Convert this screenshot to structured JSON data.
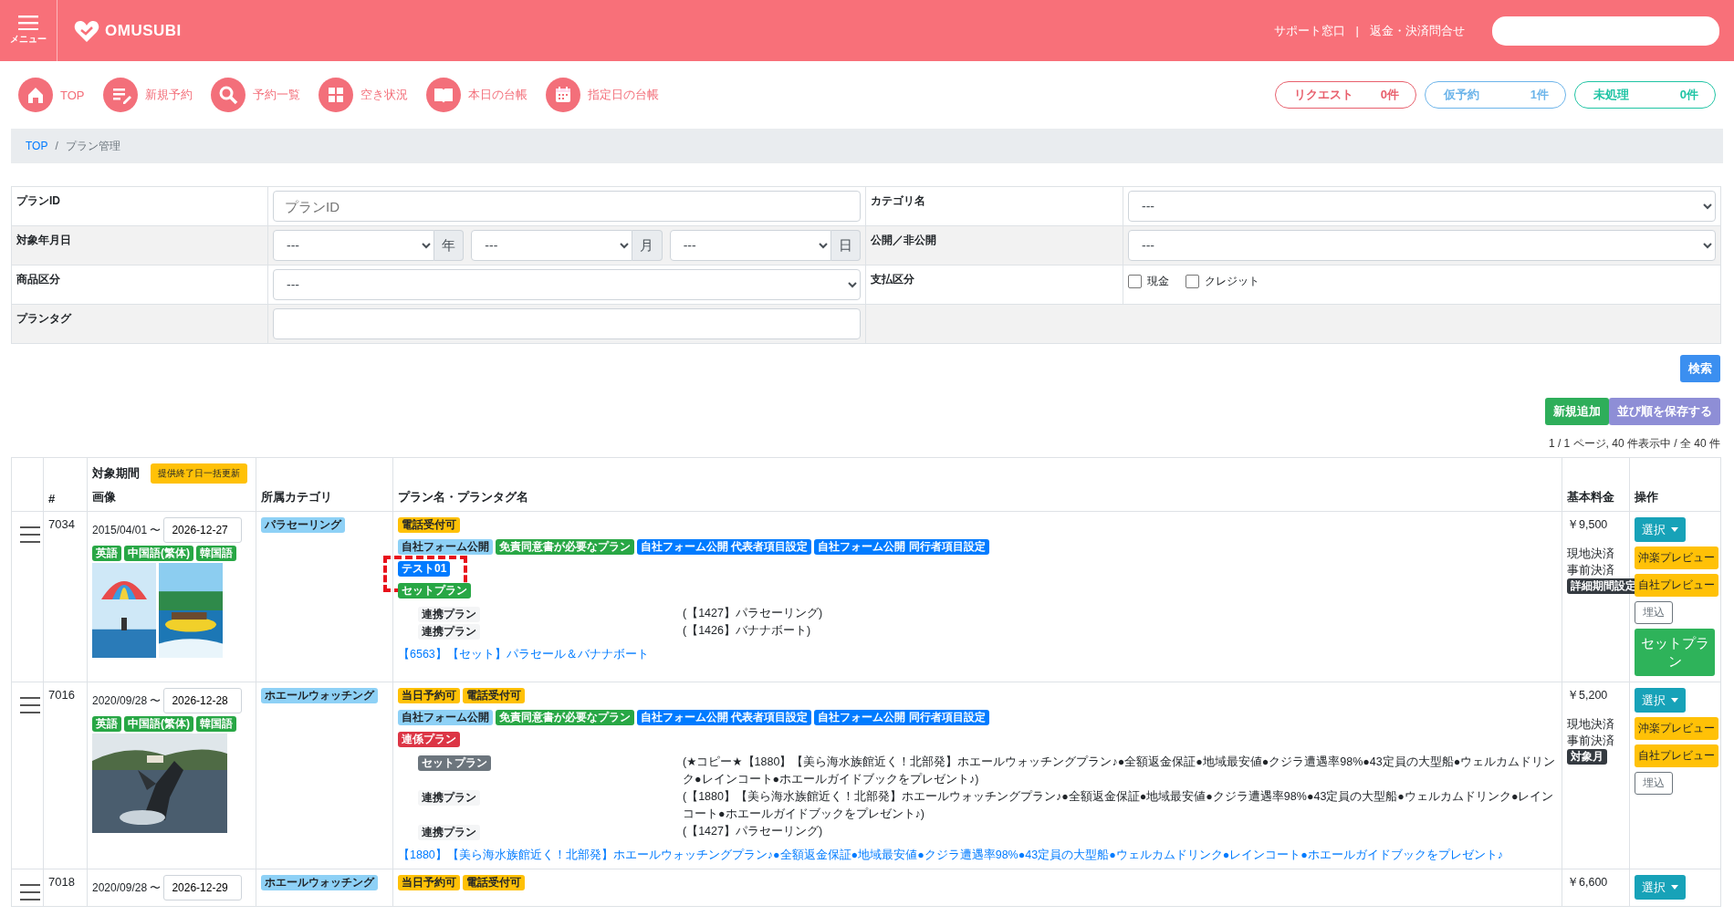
{
  "header": {
    "menu_label": "メニュー",
    "logo": "OMUSUBI",
    "links": [
      "サポート窓口",
      "返金・決済問合せ"
    ],
    "separator": "|"
  },
  "toolbar": [
    {
      "label": "TOP"
    },
    {
      "label": "新規予約"
    },
    {
      "label": "予約一覧"
    },
    {
      "label": "空き状況"
    },
    {
      "label": "本日の台帳"
    },
    {
      "label": "指定日の台帳"
    }
  ],
  "counters": [
    {
      "label": "リクエスト",
      "count": "0件",
      "color": "#e8606d"
    },
    {
      "label": "仮予約",
      "count": "1件",
      "color": "#6cb4ea"
    },
    {
      "label": "未処理",
      "count": "0件",
      "color": "#1fc4a4"
    }
  ],
  "breadcrumb": [
    {
      "label": "TOP",
      "link": true
    },
    {
      "label": "プラン管理",
      "link": false
    }
  ],
  "breadcrumb_separator": "/",
  "filters": [
    {
      "label": "プランID",
      "kind": "text",
      "placeholder": "プランID"
    },
    {
      "label": "カテゴリ名",
      "kind": "select",
      "value": "---"
    },
    {
      "label": "対象年月日",
      "kind": "date",
      "parts": [
        {
          "value": "---",
          "unit": "年"
        },
        {
          "value": "---",
          "unit": "月"
        },
        {
          "value": "---",
          "unit": "日"
        }
      ]
    },
    {
      "label": "公開／非公開",
      "kind": "select",
      "value": "---"
    },
    {
      "label": "商品区分",
      "kind": "select",
      "value": "---"
    },
    {
      "label": "支払区分",
      "kind": "checks",
      "options": [
        {
          "label": "現金",
          "checked": false
        },
        {
          "label": "クレジット",
          "checked": false
        }
      ]
    },
    {
      "label": "プランタグ",
      "kind": "text"
    }
  ],
  "search_button": "検索",
  "add_button": "新規追加",
  "save_order_button": "並び順を保存する",
  "pagination": "1 / 1 ページ, 40 件表示中 / 全 40 件",
  "table": {
    "columns": {
      "number": "#",
      "period": "対象期間",
      "bulk_update_button": "提供終了日一括更新",
      "image": "画像",
      "category": "所属カテゴリ",
      "plan": "プラン名・プランタグ名",
      "price": "基本料金",
      "actions": "操作"
    },
    "rows": [
      {
        "id": "7034",
        "start": "2015/04/01 〜",
        "end": "2026-12-27",
        "languages": [
          "英語",
          "中国語(繁体)",
          "韓国語"
        ],
        "images": [
          {
            "kind": "picture"
          },
          {
            "kind": "picture"
          }
        ],
        "category": "パラセーリング",
        "tag_rows": [
          [
            {
              "text": "電話受付可",
              "kind": "warning",
              "highlighted": false
            }
          ],
          [
            {
              "text": "自社フォーム公開",
              "kind": "info",
              "highlighted": false
            },
            {
              "text": "免責同意書が必要なプラン",
              "kind": "success",
              "highlighted": false
            },
            {
              "text": "自社フォーム公開 代表者項目設定",
              "kind": "primary",
              "highlighted": false
            },
            {
              "text": "自社フォーム公開 同行者項目設定",
              "kind": "primary",
              "highlighted": false
            }
          ],
          [
            {
              "text": "テスト01",
              "kind": "primary",
              "highlighted": true
            }
          ],
          [
            {
              "text": "セットプラン",
              "kind": "success",
              "highlighted": false
            }
          ]
        ],
        "linked_plans": [
          {
            "label": "連携プラン",
            "kind": "light",
            "text": "(【1427】パラセーリング)"
          },
          {
            "label": "連携プラン",
            "kind": "light",
            "text": "(【1426】バナナボート)"
          }
        ],
        "plan_link": "【6563】【セット】パラセール＆バナナボート",
        "price": "￥9,500",
        "payments": [
          "現地決済",
          "事前決済"
        ],
        "period_badge": "詳細期間設定",
        "actions": [
          {
            "label": "選択",
            "kind": "dropdown"
          },
          {
            "label": "沖楽プレビュー",
            "kind": "warning"
          },
          {
            "label": "自社プレビュー",
            "kind": "warning"
          },
          {
            "label": "埋込",
            "kind": "outline"
          },
          {
            "label": "セットプラン",
            "kind": "success"
          }
        ]
      },
      {
        "id": "7016",
        "start": "2020/09/28 〜",
        "end": "2026-12-28",
        "languages": [
          "英語",
          "中国語(繁体)",
          "韓国語"
        ],
        "images": [
          {
            "kind": "picture"
          }
        ],
        "category": "ホエールウォッチング",
        "tag_rows": [
          [
            {
              "text": "当日予約可",
              "kind": "warning",
              "highlighted": false
            },
            {
              "text": "電話受付可",
              "kind": "warning",
              "highlighted": false
            }
          ],
          [
            {
              "text": "自社フォーム公開",
              "kind": "info",
              "highlighted": false
            },
            {
              "text": "免責同意書が必要なプラン",
              "kind": "success",
              "highlighted": false
            },
            {
              "text": "自社フォーム公開 代表者項目設定",
              "kind": "primary",
              "highlighted": false
            },
            {
              "text": "自社フォーム公開 同行者項目設定",
              "kind": "primary",
              "highlighted": false
            }
          ],
          [
            {
              "text": "連係プラン",
              "kind": "danger",
              "highlighted": false
            }
          ]
        ],
        "linked_plans": [
          {
            "label": "セットプラン",
            "kind": "secondary",
            "text": "(★コピー★【1880】【美ら海水族館近く！北部発】ホエールウォッチングプラン♪●全額返金保証●地域最安値●クジラ遭遇率98%●43定員の大型船●ウェルカムドリンク●レインコート●ホエールガイドブックをプレゼント♪)"
          },
          {
            "label": "連携プラン",
            "kind": "light",
            "text": "(【1880】【美ら海水族館近く！北部発】ホエールウォッチングプラン♪●全額返金保証●地域最安値●クジラ遭遇率98%●43定員の大型船●ウェルカムドリンク●レインコート●ホエールガイドブックをプレゼント♪)"
          },
          {
            "label": "連携プラン",
            "kind": "light",
            "text": "(【1427】パラセーリング)"
          }
        ],
        "plan_link": "【1880】【美ら海水族館近く！北部発】ホエールウォッチングプラン♪●全額返金保証●地域最安値●クジラ遭遇率98%●43定員の大型船●ウェルカムドリンク●レインコート●ホエールガイドブックをプレゼント♪",
        "price": "￥5,200",
        "payments": [
          "現地決済",
          "事前決済"
        ],
        "period_badge": "対象月",
        "actions": [
          {
            "label": "選択",
            "kind": "dropdown"
          },
          {
            "label": "沖楽プレビュー",
            "kind": "warning"
          },
          {
            "label": "自社プレビュー",
            "kind": "warning"
          },
          {
            "label": "埋込",
            "kind": "outline"
          }
        ]
      },
      {
        "id": "7018",
        "start": "2020/09/28 〜",
        "end": "2026-12-29",
        "category": "ホエールウォッチング",
        "tag_rows": [
          [
            {
              "text": "当日予約可",
              "kind": "warning",
              "highlighted": false
            },
            {
              "text": "電話受付可",
              "kind": "warning",
              "highlighted": false
            }
          ]
        ],
        "price": "￥6,600",
        "actions": [
          {
            "label": "選択",
            "kind": "dropdown"
          }
        ]
      }
    ]
  }
}
